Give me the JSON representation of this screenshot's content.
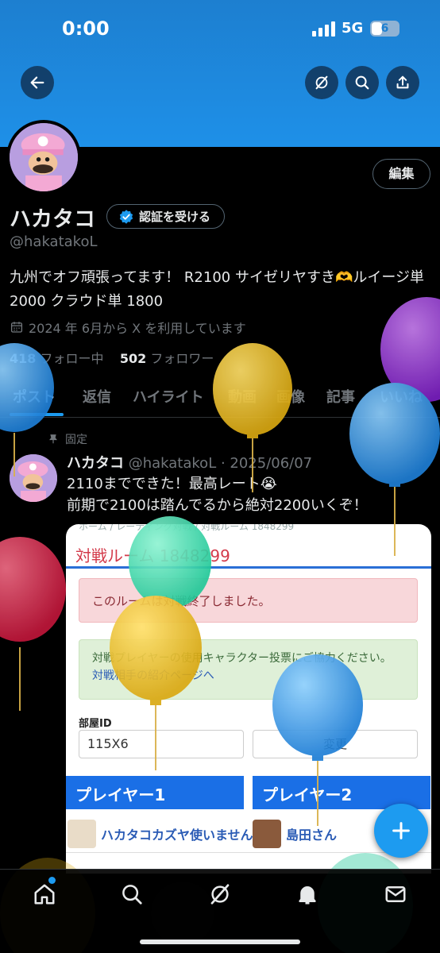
{
  "status_bar": {
    "time": "0:00",
    "network": "5G",
    "battery": "6"
  },
  "header_actions": [
    "back-arrow-icon",
    "grok-icon",
    "search-icon",
    "share-icon"
  ],
  "profile": {
    "edit_label": "編集",
    "name": "ハカタコ",
    "verify_label": "認証を受ける",
    "handle": "@hakatakoL",
    "bio": "九州でオフ頑張ってます！ R2100 サイゼリヤすき🫶ルイージ単 2000 クラウド単 1800",
    "joined": "2024 年 6月から X を利用しています",
    "following_count": "418",
    "following_label": "フォロー中",
    "followers_count": "502",
    "followers_label": "フォロワー"
  },
  "tabs": [
    "ポスト",
    "返信",
    "ハイライト",
    "動画",
    "画像",
    "記事",
    "いいね"
  ],
  "post": {
    "pinned_label": "固定",
    "author": "ハカタコ",
    "meta": "@hakatakoL · 2025/06/07",
    "line1": "2110までできた！最高レート😭",
    "line2": "前期で2100は踏んでるから絶対2200いくぞ！"
  },
  "card": {
    "breadcrumb": "ホーム / レーティング対戦 / 対戦ルーム 1848299",
    "title": "対戦ルーム 1848299",
    "alert": "このルームは対戦終了しました。",
    "notice": "対戦プレイヤーの使用キャラクター投票にご協力ください。",
    "notice_link": "対戦相手の紹介ページへ",
    "room_id_label": "部屋ID",
    "room_id_value": "115X6",
    "change_label": "変更",
    "player1": "プレイヤー1",
    "player2": "プレイヤー2",
    "player1_name": "ハカタコカズヤ使いません",
    "player2_name": "島田さん"
  },
  "colors": {
    "accent": "#1d9bf0",
    "banner": "#1e90e8",
    "alert_red": "#d33a4a"
  },
  "bottom_nav": [
    "home-icon",
    "search-icon",
    "grok-icon",
    "notifications-icon",
    "messages-icon"
  ]
}
